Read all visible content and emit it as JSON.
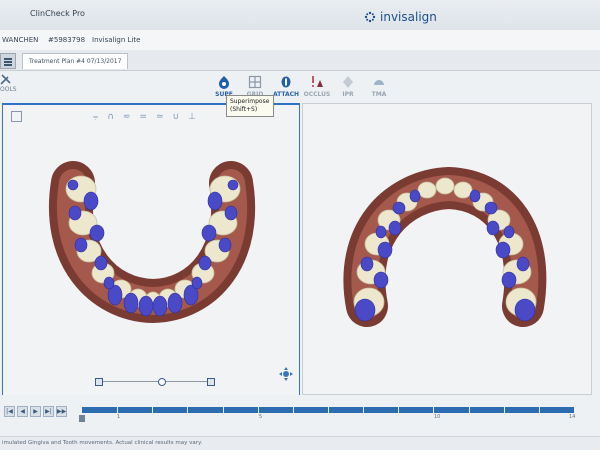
{
  "window": {
    "title": "ClinCheck Pro",
    "brand": "invisalign",
    "accent": "#2a62a8"
  },
  "patient": {
    "name": "WANCHEN",
    "id": "#5983798",
    "product": "Invisalign Lite"
  },
  "tabs": [
    {
      "label": "Treatment Plan #4 07/13/2017"
    }
  ],
  "toolbar": {
    "tools_label": "OOLS",
    "items": [
      {
        "label": "SUPE",
        "icon": "superimpose-icon",
        "active": true
      },
      {
        "label": "GRID",
        "icon": "grid-icon"
      },
      {
        "label": "ATTACH",
        "icon": "attachment-icon",
        "active": true
      },
      {
        "label": "OCCLUS",
        "icon": "occlusion-icon"
      },
      {
        "label": "IPR",
        "icon": "ipr-icon"
      },
      {
        "label": "TMA",
        "icon": "tma-icon"
      }
    ]
  },
  "tooltip": {
    "text": "Superimpose (Shift+S)"
  },
  "views": {
    "left": {
      "name": "upper-arch"
    },
    "right": {
      "name": "lower-arch"
    }
  },
  "timeline": {
    "total_stages": 14,
    "current_stage": 14,
    "ticks": [
      "1",
      "5",
      "10",
      "14"
    ],
    "flag": "14"
  },
  "status": {
    "text": "imulated Gingiva and Tooth movements. Actual clinical results may vary."
  }
}
